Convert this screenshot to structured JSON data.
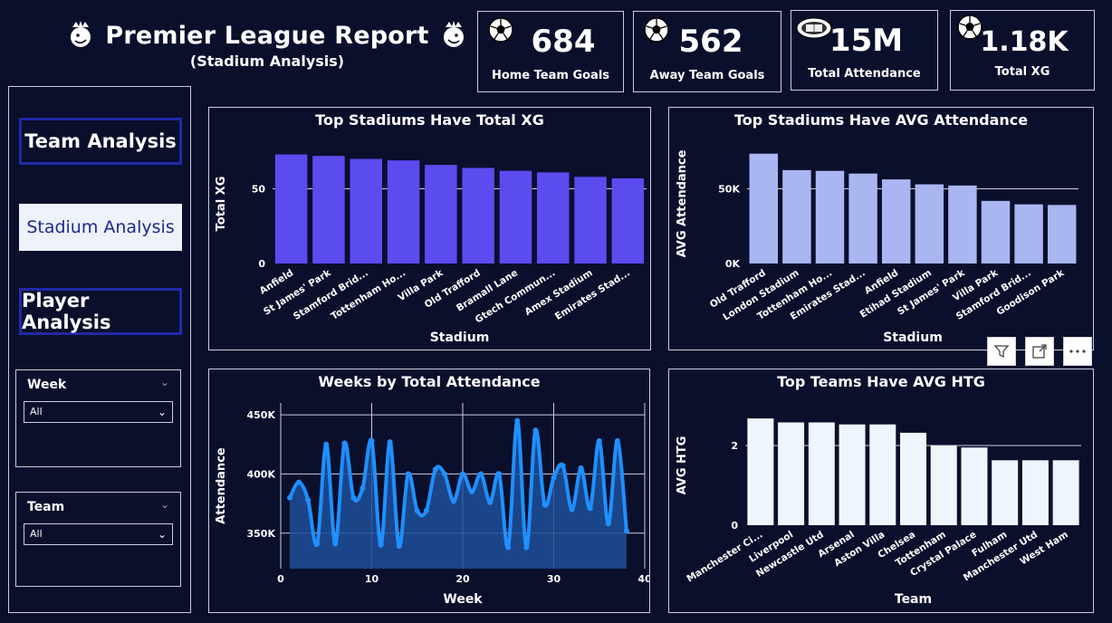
{
  "header": {
    "title": "Premier League Report",
    "subtitle": "(Stadium Analysis)"
  },
  "kpis": [
    {
      "value": "684",
      "label": "Home Team Goals",
      "icon": "soccer-ball-icon"
    },
    {
      "value": "562",
      "label": "Away Team Goals",
      "icon": "soccer-ball-icon"
    },
    {
      "value": "15M",
      "label": "Total Attendance",
      "icon": "stadium-icon"
    },
    {
      "value": "1.18K",
      "label": "Total XG",
      "icon": "soccer-ball-icon"
    }
  ],
  "nav": {
    "team": "Team Analysis",
    "stadium": "Stadium Analysis",
    "player": "Player Analysis"
  },
  "slicers": [
    {
      "title": "Week",
      "value": "All"
    },
    {
      "title": "Team",
      "value": "All"
    }
  ],
  "colors": {
    "bg": "#0a0f2c",
    "bar_purple": "#5b4cf0",
    "bar_lavender": "#a9b6f2",
    "line_blue": "#1e90ff",
    "bar_white": "#eef5fb"
  },
  "chart_data": [
    {
      "type": "bar",
      "title": "Top Stadiums Have Total XG",
      "xlabel": "Stadium",
      "ylabel": "Total XG",
      "categories": [
        "Anfield",
        "St James' Park",
        "Stamford Brid...",
        "Tottenham Ho...",
        "Villa Park",
        "Old Trafford",
        "Bramall Lane",
        "Gtech Commun...",
        "Amex Stadium",
        "Emirates Stad..."
      ],
      "values": [
        73,
        72,
        70,
        69,
        66,
        64,
        62,
        61,
        58,
        57
      ],
      "ylim": [
        0,
        80
      ],
      "yticks": [
        0,
        50
      ],
      "ytick_labels": [
        "0",
        "50"
      ],
      "grid": true
    },
    {
      "type": "bar",
      "title": "Top Stadiums Have AVG Attendance",
      "xlabel": "Stadium",
      "ylabel": "AVG Attendance",
      "categories": [
        "Old Trafford",
        "London Stadium",
        "Tottenham Ho...",
        "Emirates Stad...",
        "Anfield",
        "Etihad Stadium",
        "St James' Park",
        "Villa Park",
        "Stamford Brid...",
        "Goodison Park"
      ],
      "values": [
        73500,
        62500,
        62000,
        60200,
        56300,
        53000,
        52200,
        41900,
        39600,
        39200
      ],
      "ylim": [
        0,
        80000
      ],
      "yticks": [
        0,
        50000
      ],
      "ytick_labels": [
        "0K",
        "50K"
      ],
      "grid": true
    },
    {
      "type": "area",
      "title": "Weeks by Total Attendance",
      "xlabel": "Week",
      "ylabel": "Attendance",
      "x": [
        1,
        2,
        3,
        4,
        5,
        6,
        7,
        8,
        9,
        10,
        11,
        12,
        13,
        14,
        15,
        16,
        17,
        18,
        19,
        20,
        21,
        22,
        23,
        24,
        25,
        26,
        27,
        28,
        29,
        30,
        31,
        32,
        33,
        34,
        35,
        36,
        37,
        38
      ],
      "values": [
        380000,
        393000,
        378000,
        341000,
        425000,
        341000,
        426000,
        380000,
        388000,
        428000,
        340000,
        427000,
        339000,
        400000,
        369000,
        369000,
        404000,
        400000,
        377000,
        400000,
        385000,
        400000,
        376000,
        400000,
        338000,
        445000,
        338000,
        437000,
        374000,
        397000,
        407000,
        370000,
        405000,
        371000,
        428000,
        358000,
        428000,
        352000
      ],
      "xlim": [
        0,
        40
      ],
      "xticks": [
        0,
        10,
        20,
        30,
        40
      ],
      "ylim": [
        320000,
        460000
      ],
      "yticks": [
        350000,
        400000,
        450000
      ],
      "ytick_labels": [
        "350K",
        "400K",
        "450K"
      ],
      "grid": true
    },
    {
      "type": "bar",
      "title": "Top Teams Have AVG HTG",
      "xlabel": "Team",
      "ylabel": "AVG HTG",
      "categories": [
        "Manchester Ci...",
        "Liverpool",
        "Newcastle Utd",
        "Arsenal",
        "Aston Villa",
        "Chelsea",
        "Tottenham",
        "Crystal Palace",
        "Fulham",
        "Manchester Utd",
        "West Ham"
      ],
      "values": [
        2.68,
        2.58,
        2.58,
        2.53,
        2.53,
        2.32,
        2.0,
        1.95,
        1.63,
        1.63,
        1.63
      ],
      "ylim": [
        0,
        3
      ],
      "yticks": [
        0,
        2
      ],
      "ytick_labels": [
        "0",
        "2"
      ],
      "grid": true
    }
  ]
}
